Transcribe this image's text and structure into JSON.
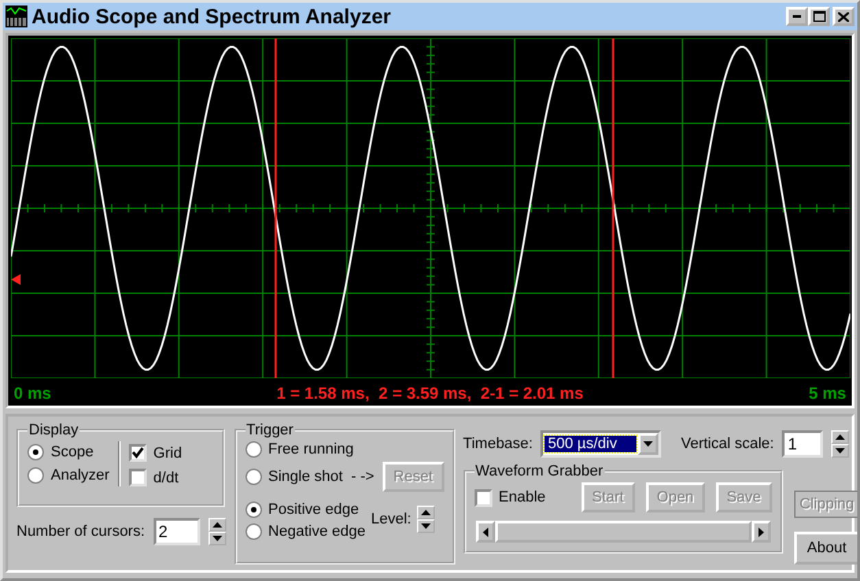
{
  "window": {
    "title": "Audio Scope and Spectrum Analyzer"
  },
  "scope": {
    "x_start": "0 ms",
    "cursor_readout": "1 = 1.58 ms,  2 = 3.59 ms,  2-1 = 2.01 ms",
    "x_end": "5 ms"
  },
  "display": {
    "title": "Display",
    "modes": [
      {
        "label": "Scope",
        "selected": true
      },
      {
        "label": "Analyzer",
        "selected": false
      }
    ],
    "options": [
      {
        "label": "Grid",
        "checked": true
      },
      {
        "label": "d/dt",
        "checked": false
      }
    ]
  },
  "cursors": {
    "label": "Number of cursors:",
    "value": "2"
  },
  "trigger": {
    "title": "Trigger",
    "run_modes": [
      {
        "label": "Free running",
        "selected": false
      },
      {
        "label": "Single shot",
        "selected": false
      }
    ],
    "arrow": "- ->",
    "reset_button": {
      "label": "Reset",
      "disabled": true
    },
    "edges": [
      {
        "label": "Positive edge",
        "selected": true
      },
      {
        "label": "Negative edge",
        "selected": false
      }
    ],
    "level_label": "Level:"
  },
  "timebase": {
    "label": "Timebase:",
    "value": "500 µs/div"
  },
  "vertical_scale": {
    "label": "Vertical scale:",
    "value": "1"
  },
  "grabber": {
    "title": "Waveform Grabber",
    "enable": {
      "label": "Enable",
      "checked": false
    },
    "buttons": [
      {
        "label": "Start",
        "disabled": true
      },
      {
        "label": "Open",
        "disabled": true
      },
      {
        "label": "Save",
        "disabled": true
      }
    ]
  },
  "side_buttons": [
    {
      "label": "Clipping",
      "disabled": true
    },
    {
      "label": "About",
      "disabled": false
    }
  ]
}
